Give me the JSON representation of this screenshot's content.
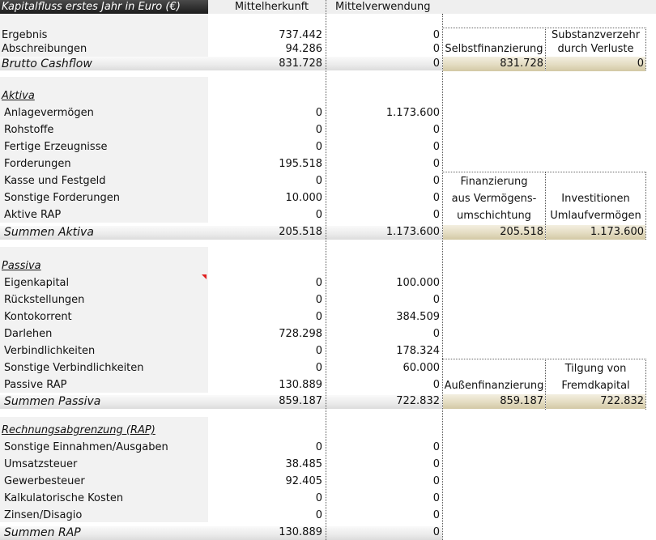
{
  "header": {
    "title": "Kapitalfluss erstes Jahr in Euro (€)",
    "col_herkunft": "Mittelherkunft",
    "col_verwendung": "Mittelverwendung"
  },
  "cashflow": {
    "rows": [
      {
        "label": "Ergebnis",
        "herkunft": "737.442",
        "verwendung": "0"
      },
      {
        "label": "Abschreibungen",
        "herkunft": "94.286",
        "verwendung": "0"
      }
    ],
    "total_label": "Brutto Cashflow",
    "total_herkunft": "831.728",
    "total_verwendung": "0"
  },
  "aktiva": {
    "heading": "Aktiva",
    "rows": [
      {
        "label": "Anlagevermögen",
        "herkunft": "0",
        "verwendung": "1.173.600"
      },
      {
        "label": "Rohstoffe",
        "herkunft": "0",
        "verwendung": "0"
      },
      {
        "label": "Fertige Erzeugnisse",
        "herkunft": "0",
        "verwendung": "0"
      },
      {
        "label": "Forderungen",
        "herkunft": "195.518",
        "verwendung": "0"
      },
      {
        "label": "Kasse und Festgeld",
        "herkunft": "0",
        "verwendung": "0"
      },
      {
        "label": "Sonstige Forderungen",
        "herkunft": "10.000",
        "verwendung": "0"
      },
      {
        "label": "Aktive RAP",
        "herkunft": "0",
        "verwendung": "0"
      }
    ],
    "total_label": "Summen Aktiva",
    "total_herkunft": "205.518",
    "total_verwendung": "1.173.600"
  },
  "passiva": {
    "heading": "Passiva",
    "rows": [
      {
        "label": "Eigenkapital",
        "herkunft": "0",
        "verwendung": "100.000"
      },
      {
        "label": "Rückstellungen",
        "herkunft": "0",
        "verwendung": "0"
      },
      {
        "label": "Kontokorrent",
        "herkunft": "0",
        "verwendung": "384.509"
      },
      {
        "label": "Darlehen",
        "herkunft": "728.298",
        "verwendung": "0"
      },
      {
        "label": "Verbindlichkeiten",
        "herkunft": "0",
        "verwendung": "178.324"
      },
      {
        "label": "Sonstige Verbindlichkeiten",
        "herkunft": "0",
        "verwendung": "60.000"
      },
      {
        "label": "Passive RAP",
        "herkunft": "130.889",
        "verwendung": "0"
      }
    ],
    "total_label": "Summen Passiva",
    "total_herkunft": "859.187",
    "total_verwendung": "722.832"
  },
  "rap": {
    "heading": "Rechnungsabgrenzung (RAP)",
    "rows": [
      {
        "label": "Sonstige Einnahmen/Ausgaben",
        "herkunft": "0",
        "verwendung": "0"
      },
      {
        "label": "Umsatzsteuer",
        "herkunft": "38.485",
        "verwendung": "0"
      },
      {
        "label": "Gewerbesteuer",
        "herkunft": "92.405",
        "verwendung": "0"
      },
      {
        "label": "Kalkulatorische Kosten",
        "herkunft": "0",
        "verwendung": "0"
      },
      {
        "label": "Zinsen/Disagio",
        "herkunft": "0",
        "verwendung": "0"
      }
    ],
    "total_label": "Summen RAP",
    "total_herkunft": "130.889",
    "total_verwendung": "0"
  },
  "summary": {
    "box1": {
      "left_label": "Selbstfinanzierung",
      "left_value": "831.728",
      "right_label_1": "Substanzverzehr",
      "right_label_2": "durch Verluste",
      "right_value": "0"
    },
    "box2": {
      "left_label_1": "Finanzierung",
      "left_label_2": "aus Vermögens-",
      "left_label_3": "umschichtung",
      "left_value": "205.518",
      "right_label_1": "Investitionen",
      "right_label_2": "Umlaufvermögen",
      "right_value": "1.173.600"
    },
    "box3": {
      "left_label": "Außenfinanzierung",
      "left_value": "859.187",
      "right_label_1": "Tilgung von",
      "right_label_2": "Fremdkapital",
      "right_value": "722.832"
    }
  },
  "colors": {
    "header_dark": "#2a2a2a",
    "label_bg": "#f2f2f2",
    "sum_bg": "#e4dcc2",
    "comment_marker": "#e02020"
  }
}
